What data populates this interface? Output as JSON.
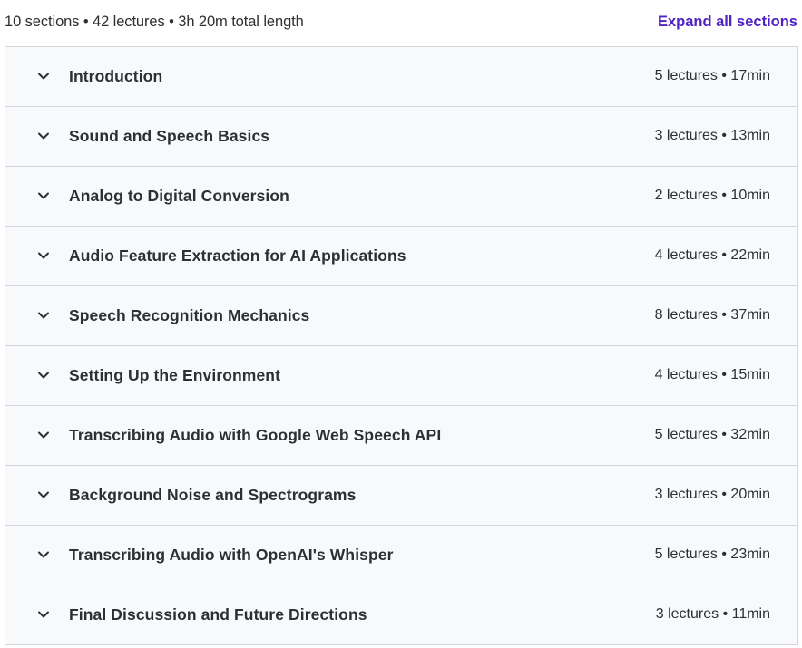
{
  "summary": {
    "text": "10 sections • 42 lectures • 3h 20m total length",
    "expand_all_label": "Expand all sections"
  },
  "colors": {
    "accent": "#5022c3",
    "section_bg": "#f7f9fa",
    "border": "#d1d7dc",
    "text": "#2d2f31"
  },
  "sections": [
    {
      "title": "Introduction",
      "meta": "5 lectures • 17min",
      "icon": "chevron-down-icon"
    },
    {
      "title": "Sound and Speech Basics",
      "meta": "3 lectures • 13min",
      "icon": "chevron-down-icon"
    },
    {
      "title": "Analog to Digital Conversion",
      "meta": "2 lectures • 10min",
      "icon": "chevron-down-icon"
    },
    {
      "title": "Audio Feature Extraction for AI Applications",
      "meta": "4 lectures • 22min",
      "icon": "chevron-down-icon"
    },
    {
      "title": "Speech Recognition Mechanics",
      "meta": "8 lectures • 37min",
      "icon": "chevron-down-icon"
    },
    {
      "title": "Setting Up the Environment",
      "meta": "4 lectures • 15min",
      "icon": "chevron-down-icon"
    },
    {
      "title": "Transcribing Audio with Google Web Speech API",
      "meta": "5 lectures • 32min",
      "icon": "chevron-down-icon"
    },
    {
      "title": "Background Noise and Spectrograms",
      "meta": "3 lectures • 20min",
      "icon": "chevron-down-icon"
    },
    {
      "title": "Transcribing Audio with OpenAI's Whisper",
      "meta": "5 lectures • 23min",
      "icon": "chevron-down-icon"
    },
    {
      "title": "Final Discussion and Future Directions",
      "meta": "3 lectures • 11min",
      "icon": "chevron-down-icon"
    }
  ]
}
